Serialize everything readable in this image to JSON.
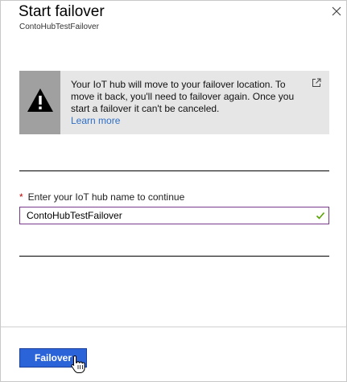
{
  "blade": {
    "title": "Start failover",
    "subtitle": "ContoHubTestFailover"
  },
  "warning": {
    "message": "Your IoT hub will move to your failover location. To move it back, you'll need to failover again. Once you start a failover it can't be canceled.",
    "link_label": "Learn more",
    "icon": "warning-icon"
  },
  "form": {
    "label": "Enter your IoT hub name to continue",
    "required_marker": "*",
    "value": "ContoHubTestFailover",
    "valid": true
  },
  "footer": {
    "primary_label": "Failover"
  },
  "colors": {
    "accent": "#2b64d8",
    "link": "#2f6fc6",
    "required": "#c00000",
    "valid": "#57a300"
  }
}
